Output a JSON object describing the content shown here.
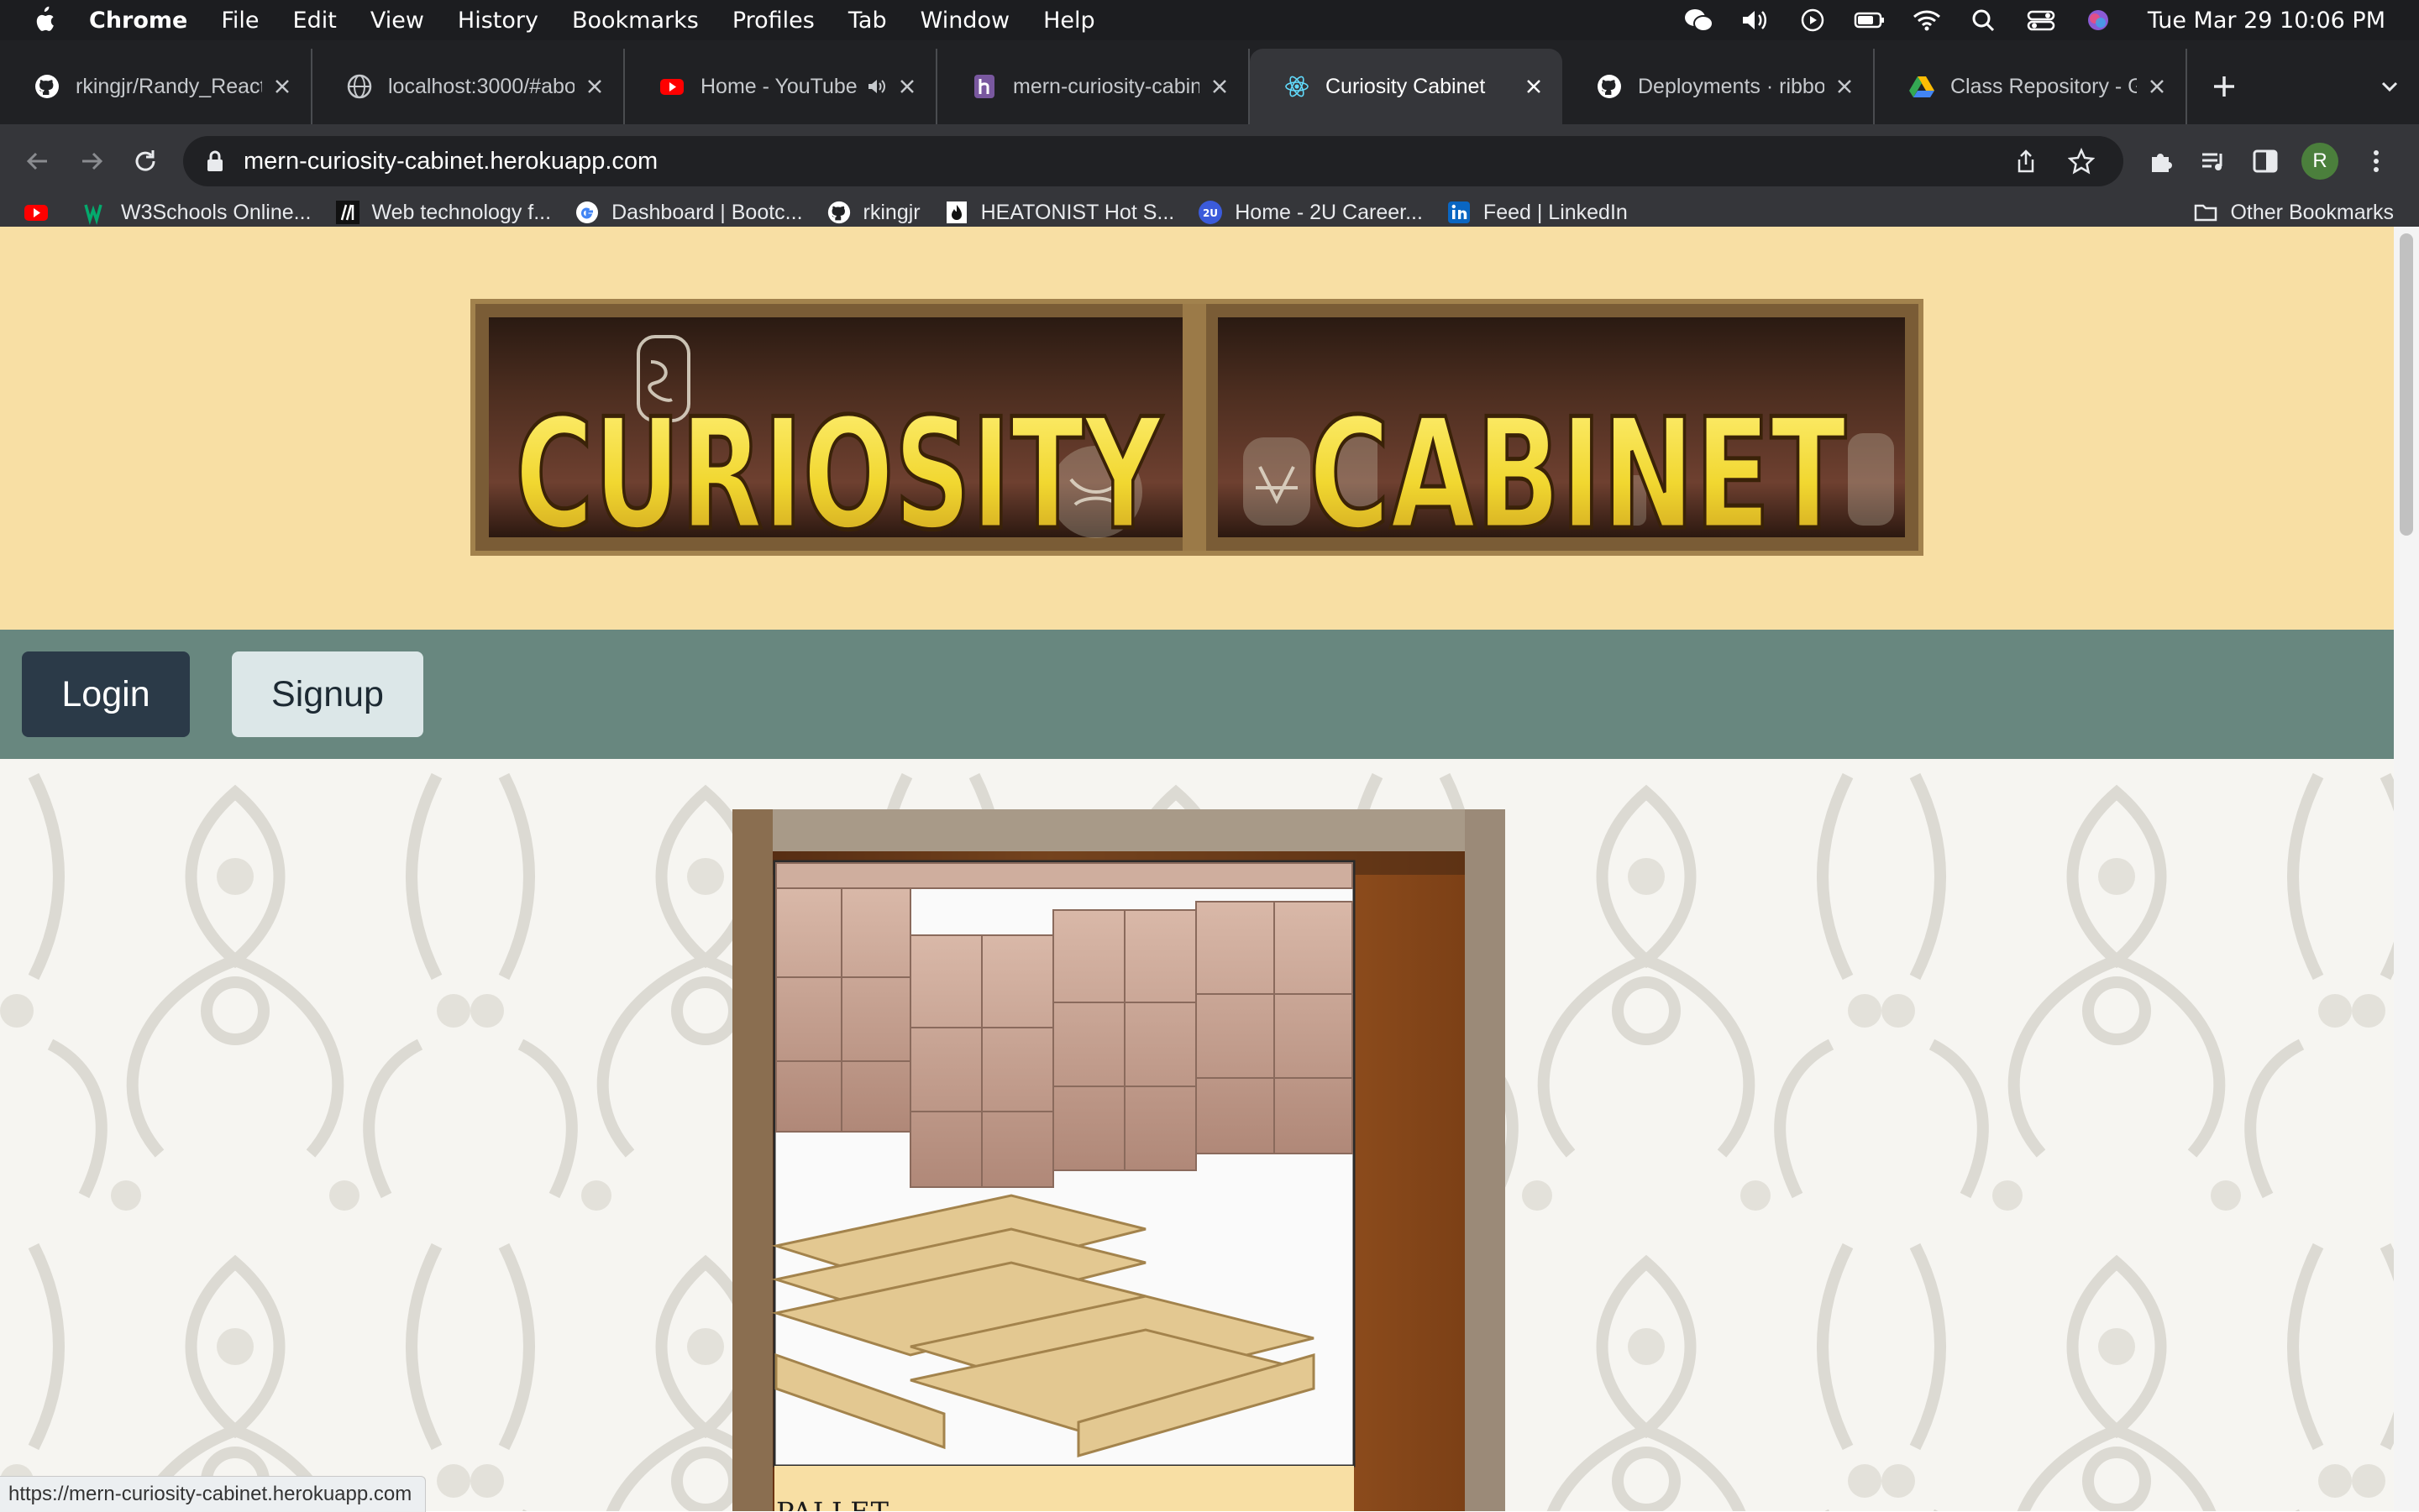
{
  "menubar": {
    "app": "Chrome",
    "items": [
      "File",
      "Edit",
      "View",
      "History",
      "Bookmarks",
      "Profiles",
      "Tab",
      "Window",
      "Help"
    ],
    "clock": "Tue Mar 29  10:06 PM"
  },
  "tabs": [
    {
      "title": "rkingjr/Randy_React_",
      "icon": "github-icon"
    },
    {
      "title": "localhost:3000/#abou",
      "icon": "globe-icon"
    },
    {
      "title": "Home - YouTube",
      "icon": "youtube-icon",
      "audio": true
    },
    {
      "title": "mern-curiosity-cabine",
      "icon": "heroku-icon"
    },
    {
      "title": "Curiosity Cabinet",
      "icon": "react-icon",
      "active": true
    },
    {
      "title": "Deployments · ribbon",
      "icon": "github-icon"
    },
    {
      "title": "Class Repository - Go",
      "icon": "google-drive-icon"
    }
  ],
  "toolbar": {
    "url": "mern-curiosity-cabinet.herokuapp.com",
    "profile_initial": "R"
  },
  "bookmarks": {
    "items": [
      {
        "label": "",
        "icon": "youtube-icon"
      },
      {
        "label": "W3Schools Online...",
        "icon": "w3schools-icon"
      },
      {
        "label": "Web technology f...",
        "icon": "mdn-icon"
      },
      {
        "label": "Dashboard | Bootc...",
        "icon": "google-icon"
      },
      {
        "label": "rkingjr",
        "icon": "github-icon"
      },
      {
        "label": "HEATONIST Hot S...",
        "icon": "heatonist-icon"
      },
      {
        "label": "Home - 2U Career...",
        "icon": "2u-icon"
      },
      {
        "label": "Feed | LinkedIn",
        "icon": "linkedin-icon"
      }
    ],
    "other": "Other Bookmarks"
  },
  "page": {
    "banner_word_1": "CURIOSITY",
    "banner_word_2": "CABINET",
    "login_label": "Login",
    "signup_label": "Signup",
    "card_label": "PALLET"
  },
  "status_url": "https://mern-curiosity-cabinet.herokuapp.com",
  "colors": {
    "header_bg": "#f8dfa4",
    "nav_band": "#68877f",
    "login_button": "#2b3a48",
    "signup_button": "#dce7e8"
  }
}
